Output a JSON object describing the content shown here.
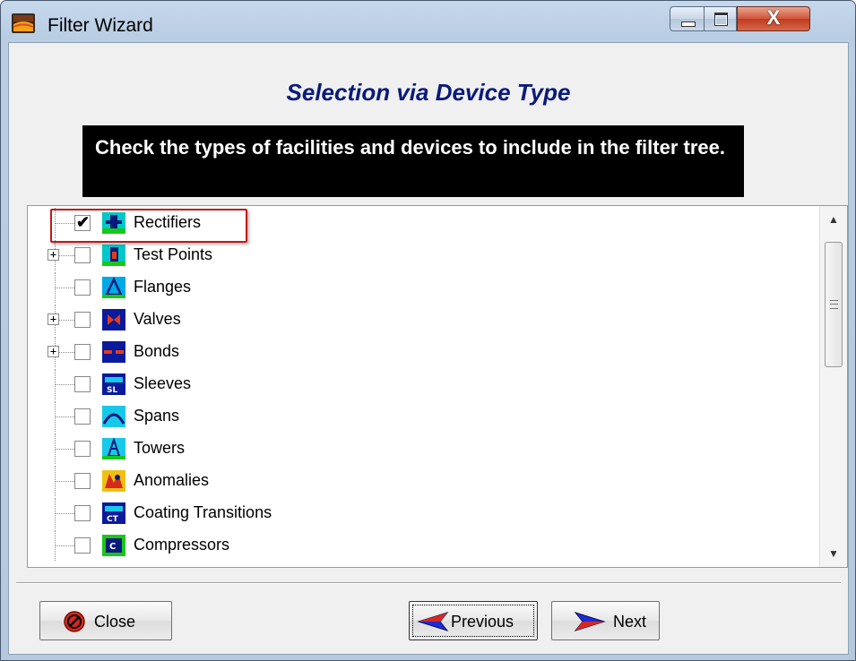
{
  "window": {
    "title": "Filter Wizard",
    "controls": {
      "minimize": "minimize",
      "maximize": "maximize",
      "close": "X"
    }
  },
  "heading": "Selection via Device Type",
  "instructions": "Check the types of facilities and devices to include in the filter tree.",
  "tree": {
    "items": [
      {
        "label": "Rectifiers",
        "checked": true,
        "expandable": false,
        "icon": "rectifier-icon"
      },
      {
        "label": "Test Points",
        "checked": false,
        "expandable": true,
        "icon": "test-point-icon"
      },
      {
        "label": "Flanges",
        "checked": false,
        "expandable": false,
        "icon": "flange-icon"
      },
      {
        "label": "Valves",
        "checked": false,
        "expandable": true,
        "icon": "valve-icon"
      },
      {
        "label": "Bonds",
        "checked": false,
        "expandable": true,
        "icon": "bond-icon"
      },
      {
        "label": "Sleeves",
        "checked": false,
        "expandable": false,
        "icon": "sleeve-icon"
      },
      {
        "label": "Spans",
        "checked": false,
        "expandable": false,
        "icon": "span-icon"
      },
      {
        "label": "Towers",
        "checked": false,
        "expandable": false,
        "icon": "tower-icon"
      },
      {
        "label": "Anomalies",
        "checked": false,
        "expandable": false,
        "icon": "anomaly-icon"
      },
      {
        "label": "Coating Transitions",
        "checked": false,
        "expandable": false,
        "icon": "coating-transition-icon"
      },
      {
        "label": "Compressors",
        "checked": false,
        "expandable": false,
        "icon": "compressor-icon"
      }
    ]
  },
  "buttons": {
    "close": "Close",
    "previous": "Previous",
    "next": "Next"
  },
  "colors": {
    "heading": "#0a1a7a",
    "instructions_bg": "#000000",
    "highlight": "#c01a1a"
  }
}
